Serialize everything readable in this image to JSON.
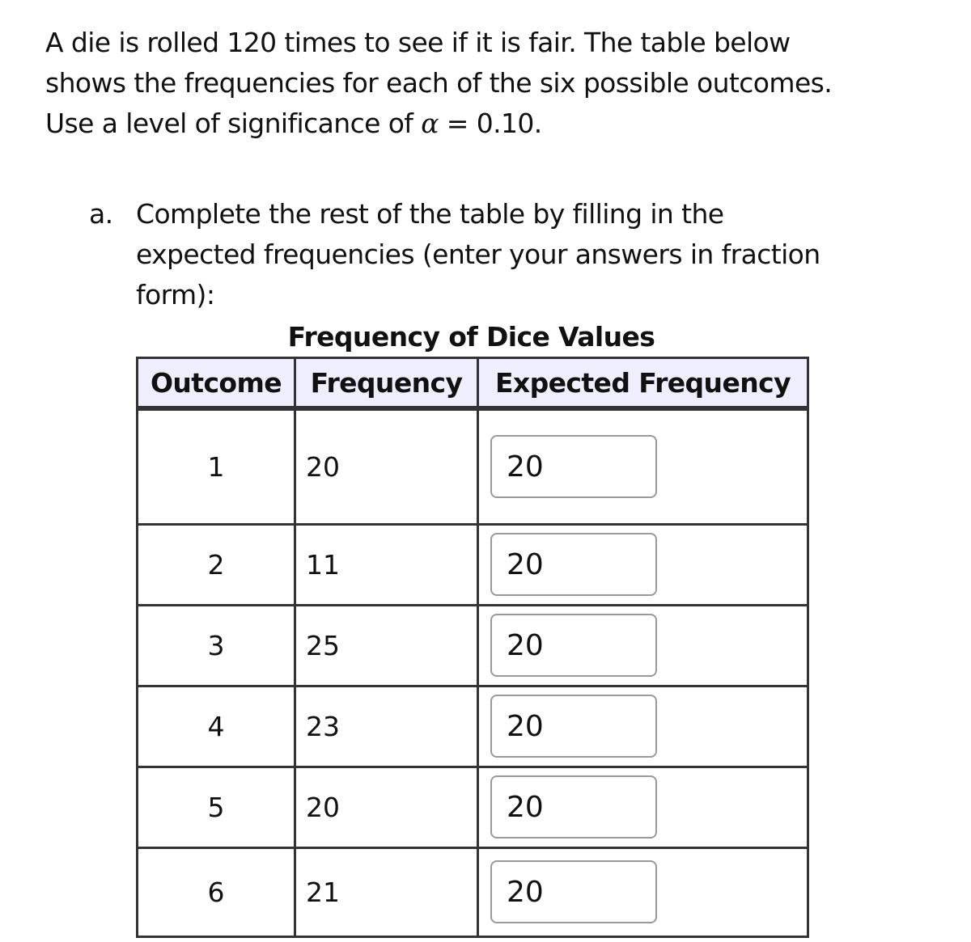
{
  "intro": {
    "lines": [
      "A die is rolled 120 times to see if it is fair. The table below",
      "shows the frequencies for each of the six possible outcomes."
    ],
    "line3_prefix": " Use a level of significance of ",
    "alpha_symbol": "α",
    "line3_suffix": " = 0.10."
  },
  "part_a": {
    "label": "a.",
    "lines": [
      "Complete the rest of the table by filling in the",
      "expected frequencies (enter your answers in fraction",
      "form):"
    ]
  },
  "table": {
    "caption": "Frequency of Dice Values",
    "headers": [
      "Outcome",
      "Frequency",
      "Expected Frequency"
    ],
    "rows": [
      {
        "outcome": "1",
        "frequency": "20",
        "expected": "20"
      },
      {
        "outcome": "2",
        "frequency": "11",
        "expected": "20"
      },
      {
        "outcome": "3",
        "frequency": "25",
        "expected": "20"
      },
      {
        "outcome": "4",
        "frequency": "23",
        "expected": "20"
      },
      {
        "outcome": "5",
        "frequency": "20",
        "expected": "20"
      },
      {
        "outcome": "6",
        "frequency": "21",
        "expected": "20"
      }
    ]
  },
  "colors": {
    "header_bg": "#eeeeff",
    "border": "#333333",
    "input_border": "#999999"
  }
}
